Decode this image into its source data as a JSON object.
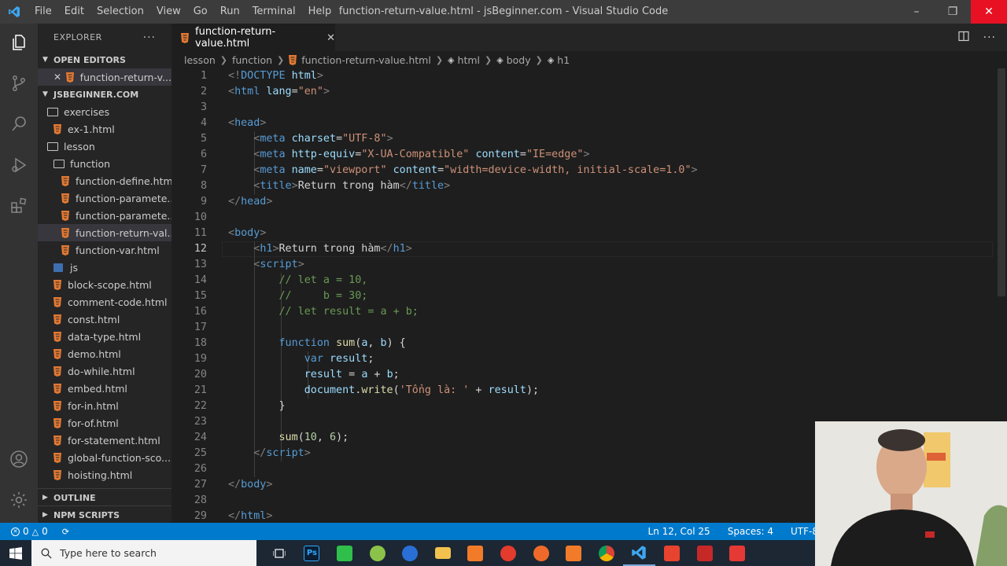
{
  "window": {
    "title": "function-return-value.html - jsBeginner.com - Visual Studio Code",
    "menu": [
      "File",
      "Edit",
      "Selection",
      "View",
      "Go",
      "Run",
      "Terminal",
      "Help"
    ]
  },
  "sidebar": {
    "header": "EXPLORER",
    "open_editors_label": "OPEN EDITORS",
    "open_editor_file": "function-return-v...",
    "workspace_label": "JSBEGINNER.COM",
    "tree": [
      {
        "label": "exercises",
        "kind": "folder",
        "depth": 1
      },
      {
        "label": "ex-1.html",
        "kind": "html",
        "depth": 2
      },
      {
        "label": "lesson",
        "kind": "folder",
        "depth": 1
      },
      {
        "label": "function",
        "kind": "folder",
        "depth": 2
      },
      {
        "label": "function-define.html",
        "kind": "html",
        "depth": 3
      },
      {
        "label": "function-paramete...",
        "kind": "html",
        "depth": 3
      },
      {
        "label": "function-paramete...",
        "kind": "html",
        "depth": 3
      },
      {
        "label": "function-return-val...",
        "kind": "html",
        "depth": 3,
        "active": true
      },
      {
        "label": "function-var.html",
        "kind": "html",
        "depth": 3
      },
      {
        "label": "js",
        "kind": "jsfolder",
        "depth": 2
      },
      {
        "label": "block-scope.html",
        "kind": "html",
        "depth": 2
      },
      {
        "label": "comment-code.html",
        "kind": "html",
        "depth": 2
      },
      {
        "label": "const.html",
        "kind": "html",
        "depth": 2
      },
      {
        "label": "data-type.html",
        "kind": "html",
        "depth": 2
      },
      {
        "label": "demo.html",
        "kind": "html",
        "depth": 2
      },
      {
        "label": "do-while.html",
        "kind": "html",
        "depth": 2
      },
      {
        "label": "embed.html",
        "kind": "html",
        "depth": 2
      },
      {
        "label": "for-in.html",
        "kind": "html",
        "depth": 2
      },
      {
        "label": "for-of.html",
        "kind": "html",
        "depth": 2
      },
      {
        "label": "for-statement.html",
        "kind": "html",
        "depth": 2
      },
      {
        "label": "global-function-sco...",
        "kind": "html",
        "depth": 2
      },
      {
        "label": "hoisting.html",
        "kind": "html",
        "depth": 2
      }
    ],
    "outline_label": "OUTLINE",
    "npm_label": "NPM SCRIPTS"
  },
  "editor": {
    "tab_label": "function-return-value.html",
    "breadcrumb": [
      "lesson",
      "function",
      "function-return-value.html",
      "html",
      "body",
      "h1"
    ],
    "current_line": 12,
    "lines": [
      [
        [
          "b",
          "<!"
        ],
        [
          "t",
          "DOCTYPE "
        ],
        [
          "a",
          "html"
        ],
        [
          "b",
          ">"
        ]
      ],
      [
        [
          "b",
          "<"
        ],
        [
          "t",
          "html"
        ],
        [
          "x",
          " "
        ],
        [
          "a",
          "lang"
        ],
        [
          "x",
          "="
        ],
        [
          "s",
          "\"en\""
        ],
        [
          "b",
          ">"
        ]
      ],
      [],
      [
        [
          "b",
          "<"
        ],
        [
          "t",
          "head"
        ],
        [
          "b",
          ">"
        ]
      ],
      [
        [
          "x",
          "    "
        ],
        [
          "b",
          "<"
        ],
        [
          "t",
          "meta"
        ],
        [
          "x",
          " "
        ],
        [
          "a",
          "charset"
        ],
        [
          "x",
          "="
        ],
        [
          "s",
          "\"UTF-8\""
        ],
        [
          "b",
          ">"
        ]
      ],
      [
        [
          "x",
          "    "
        ],
        [
          "b",
          "<"
        ],
        [
          "t",
          "meta"
        ],
        [
          "x",
          " "
        ],
        [
          "a",
          "http-equiv"
        ],
        [
          "x",
          "="
        ],
        [
          "s",
          "\"X-UA-Compatible\""
        ],
        [
          "x",
          " "
        ],
        [
          "a",
          "content"
        ],
        [
          "x",
          "="
        ],
        [
          "s",
          "\"IE=edge\""
        ],
        [
          "b",
          ">"
        ]
      ],
      [
        [
          "x",
          "    "
        ],
        [
          "b",
          "<"
        ],
        [
          "t",
          "meta"
        ],
        [
          "x",
          " "
        ],
        [
          "a",
          "name"
        ],
        [
          "x",
          "="
        ],
        [
          "s",
          "\"viewport\""
        ],
        [
          "x",
          " "
        ],
        [
          "a",
          "content"
        ],
        [
          "x",
          "="
        ],
        [
          "s",
          "\"width=device-width, initial-scale=1.0\""
        ],
        [
          "b",
          ">"
        ]
      ],
      [
        [
          "x",
          "    "
        ],
        [
          "b",
          "<"
        ],
        [
          "t",
          "title"
        ],
        [
          "b",
          ">"
        ],
        [
          "x",
          "Return trong hàm"
        ],
        [
          "b",
          "</"
        ],
        [
          "t",
          "title"
        ],
        [
          "b",
          ">"
        ]
      ],
      [
        [
          "b",
          "</"
        ],
        [
          "t",
          "head"
        ],
        [
          "b",
          ">"
        ]
      ],
      [],
      [
        [
          "b",
          "<"
        ],
        [
          "t",
          "body"
        ],
        [
          "b",
          ">"
        ]
      ],
      [
        [
          "x",
          "    "
        ],
        [
          "b",
          "<"
        ],
        [
          "t",
          "h1"
        ],
        [
          "b",
          ">"
        ],
        [
          "x",
          "Return trong hàm"
        ],
        [
          "b",
          "</"
        ],
        [
          "t",
          "h1"
        ],
        [
          "b",
          ">"
        ]
      ],
      [
        [
          "x",
          "    "
        ],
        [
          "b",
          "<"
        ],
        [
          "t",
          "script"
        ],
        [
          "b",
          ">"
        ]
      ],
      [
        [
          "x",
          "        "
        ],
        [
          "c",
          "// let a = 10,"
        ]
      ],
      [
        [
          "x",
          "        "
        ],
        [
          "c",
          "//     b = 30;"
        ]
      ],
      [
        [
          "x",
          "        "
        ],
        [
          "c",
          "// let result = a + b;"
        ]
      ],
      [],
      [
        [
          "x",
          "        "
        ],
        [
          "k",
          "function"
        ],
        [
          "x",
          " "
        ],
        [
          "f",
          "sum"
        ],
        [
          "x",
          "("
        ],
        [
          "v",
          "a"
        ],
        [
          "x",
          ", "
        ],
        [
          "v",
          "b"
        ],
        [
          "x",
          ") {"
        ]
      ],
      [
        [
          "x",
          "            "
        ],
        [
          "k",
          "var"
        ],
        [
          "x",
          " "
        ],
        [
          "v",
          "result"
        ],
        [
          "x",
          ";"
        ]
      ],
      [
        [
          "x",
          "            "
        ],
        [
          "v",
          "result"
        ],
        [
          "x",
          " = "
        ],
        [
          "v",
          "a"
        ],
        [
          "x",
          " + "
        ],
        [
          "v",
          "b"
        ],
        [
          "x",
          ";"
        ]
      ],
      [
        [
          "x",
          "            "
        ],
        [
          "v",
          "document"
        ],
        [
          "x",
          "."
        ],
        [
          "f",
          "write"
        ],
        [
          "x",
          "("
        ],
        [
          "s",
          "'Tổng là: '"
        ],
        [
          "x",
          " + "
        ],
        [
          "v",
          "result"
        ],
        [
          "x",
          ");"
        ]
      ],
      [
        [
          "x",
          "        }"
        ]
      ],
      [],
      [
        [
          "x",
          "        "
        ],
        [
          "f",
          "sum"
        ],
        [
          "x",
          "("
        ],
        [
          "n",
          "10"
        ],
        [
          "x",
          ", "
        ],
        [
          "n",
          "6"
        ],
        [
          "x",
          ");"
        ]
      ],
      [
        [
          "x",
          "    "
        ],
        [
          "b",
          "</"
        ],
        [
          "t",
          "script"
        ],
        [
          "b",
          ">"
        ]
      ],
      [],
      [
        [
          "b",
          "</"
        ],
        [
          "t",
          "body"
        ],
        [
          "b",
          ">"
        ]
      ],
      [],
      [
        [
          "b",
          "</"
        ],
        [
          "t",
          "html"
        ],
        [
          "b",
          ">"
        ]
      ]
    ]
  },
  "statusbar": {
    "errors": "0",
    "warnings": "0",
    "position": "Ln 12, Col 25",
    "spaces": "Spaces: 4",
    "encoding": "UTF-8"
  },
  "taskbar": {
    "search_placeholder": "Type here to search",
    "apps": [
      "task-view",
      "photoshop",
      "camtasia",
      "notepad-plus-plus",
      "browser-edge",
      "file-explorer",
      "xampp",
      "tomato-app",
      "media-app",
      "xampp-2",
      "chrome",
      "vscode",
      "xampp-3",
      "filezilla",
      "app-red"
    ]
  },
  "colors": {
    "accent": "#007acc",
    "titlebar": "#3c3c3c",
    "editor_bg": "#1e1e1e",
    "sidebar_bg": "#252526",
    "html_icon": "#e37933"
  }
}
